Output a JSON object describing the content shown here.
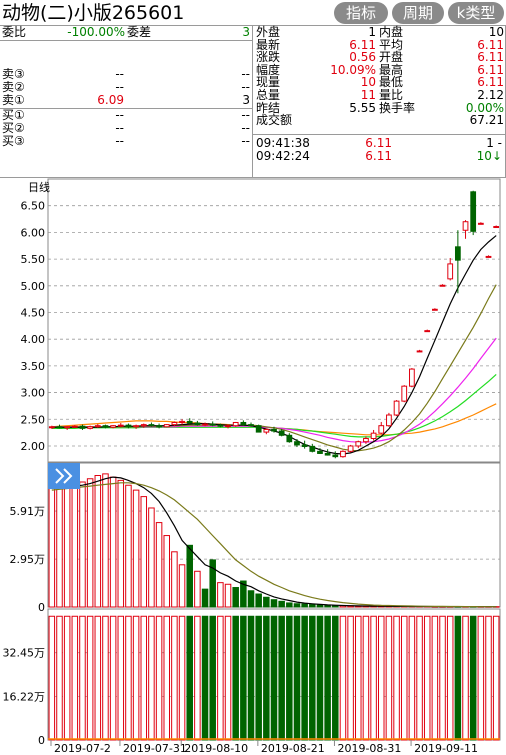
{
  "header": {
    "title": "动物(二)小版265601",
    "buttons": [
      "指标",
      "周期",
      "k类型"
    ]
  },
  "order_book": {
    "weibi_label": "委比",
    "weibi_value": "-100.00%",
    "weicha_label": "委差",
    "weicha_value": "3",
    "sells": [
      {
        "label": "卖③",
        "price": "--",
        "vol": "--"
      },
      {
        "label": "卖②",
        "price": "--",
        "vol": "--"
      },
      {
        "label": "卖①",
        "price": "6.09",
        "vol": "3"
      }
    ],
    "buys": [
      {
        "label": "买①",
        "price": "--",
        "vol": "--"
      },
      {
        "label": "买②",
        "price": "--",
        "vol": "--"
      },
      {
        "label": "买③",
        "price": "--",
        "vol": "--"
      }
    ]
  },
  "stats": {
    "rows": [
      {
        "l1": "外盘",
        "v1": "1",
        "l2": "内盘",
        "v2": "10",
        "c1": "black",
        "c2": "black"
      },
      {
        "l1": "最新",
        "v1": "6.11",
        "l2": "平均",
        "v2": "6.11",
        "c1": "red",
        "c2": "red"
      },
      {
        "l1": "涨跌",
        "v1": "0.56",
        "l2": "开盘",
        "v2": "6.11",
        "c1": "red",
        "c2": "red"
      },
      {
        "l1": "幅度",
        "v1": "10.09%",
        "l2": "最高",
        "v2": "6.11",
        "c1": "red",
        "c2": "red"
      },
      {
        "l1": "现量",
        "v1": "10",
        "l2": "最低",
        "v2": "6.11",
        "c1": "red",
        "c2": "red"
      },
      {
        "l1": "总量",
        "v1": "11",
        "l2": "量比",
        "v2": "2.12",
        "c1": "red",
        "c2": "black"
      },
      {
        "l1": "昨结",
        "v1": "5.55",
        "l2": "换手率",
        "v2": "0.00%",
        "c1": "black",
        "c2": "green"
      },
      {
        "l1": "成交额",
        "v1": "",
        "l2": "",
        "v2": "67.21",
        "c1": "black",
        "c2": "black"
      }
    ],
    "ticks": [
      {
        "time": "09:41:38",
        "price": "6.11",
        "vol": "1 -"
      },
      {
        "time": "09:42:24",
        "price": "6.11",
        "vol": "10↓"
      }
    ]
  },
  "colors": {
    "up": "#e0000f",
    "down": "#006400",
    "ma5": "#000000",
    "ma10": "#7a7a1a",
    "ma20": "#ee22ee",
    "ma30": "#22dd22",
    "ma60": "#ff8800",
    "grid": "#9a9a9a"
  },
  "chart_data": [
    {
      "type": "candlestick",
      "period_label": "日线",
      "y_ticks": [
        "6.50",
        "6.00",
        "5.50",
        "5.00",
        "4.50",
        "4.00",
        "3.50",
        "3.00",
        "2.50",
        "2.00"
      ],
      "ylim": [
        1.7,
        7.0
      ],
      "candles": [
        [
          2.35,
          2.38,
          2.32,
          2.36
        ],
        [
          2.36,
          2.4,
          2.33,
          2.34
        ],
        [
          2.34,
          2.37,
          2.3,
          2.36
        ],
        [
          2.36,
          2.39,
          2.34,
          2.37
        ],
        [
          2.37,
          2.4,
          2.3,
          2.33
        ],
        [
          2.33,
          2.38,
          2.31,
          2.36
        ],
        [
          2.36,
          2.41,
          2.34,
          2.38
        ],
        [
          2.38,
          2.4,
          2.33,
          2.35
        ],
        [
          2.35,
          2.39,
          2.33,
          2.38
        ],
        [
          2.38,
          2.43,
          2.35,
          2.39
        ],
        [
          2.39,
          2.42,
          2.33,
          2.36
        ],
        [
          2.36,
          2.4,
          2.32,
          2.38
        ],
        [
          2.38,
          2.42,
          2.34,
          2.4
        ],
        [
          2.4,
          2.44,
          2.36,
          2.38
        ],
        [
          2.38,
          2.42,
          2.33,
          2.36
        ],
        [
          2.36,
          2.41,
          2.35,
          2.4
        ],
        [
          2.4,
          2.46,
          2.37,
          2.44
        ],
        [
          2.44,
          2.5,
          2.4,
          2.46
        ],
        [
          2.46,
          2.52,
          2.41,
          2.43
        ],
        [
          2.43,
          2.47,
          2.38,
          2.4
        ],
        [
          2.4,
          2.44,
          2.37,
          2.41
        ],
        [
          2.41,
          2.46,
          2.37,
          2.39
        ],
        [
          2.39,
          2.42,
          2.35,
          2.37
        ],
        [
          2.37,
          2.4,
          2.33,
          2.38
        ],
        [
          2.38,
          2.45,
          2.36,
          2.44
        ],
        [
          2.44,
          2.48,
          2.38,
          2.4
        ],
        [
          2.4,
          2.44,
          2.36,
          2.38
        ],
        [
          2.38,
          2.4,
          2.3,
          2.26
        ],
        [
          2.26,
          2.33,
          2.22,
          2.31
        ],
        [
          2.31,
          2.36,
          2.25,
          2.28
        ],
        [
          2.28,
          2.32,
          2.18,
          2.2
        ],
        [
          2.2,
          2.24,
          2.06,
          2.08
        ],
        [
          2.08,
          2.13,
          1.98,
          2.02
        ],
        [
          2.02,
          2.1,
          1.95,
          1.99
        ],
        [
          1.99,
          2.04,
          1.88,
          1.9
        ],
        [
          1.9,
          1.96,
          1.85,
          1.86
        ],
        [
          1.86,
          1.94,
          1.82,
          1.83
        ],
        [
          1.83,
          1.9,
          1.77,
          1.8
        ],
        [
          1.8,
          1.92,
          1.78,
          1.9
        ],
        [
          1.9,
          2.02,
          1.88,
          2.0
        ],
        [
          2.0,
          2.1,
          1.96,
          2.08
        ],
        [
          2.08,
          2.18,
          2.04,
          2.14
        ],
        [
          2.14,
          2.3,
          2.1,
          2.24
        ],
        [
          2.24,
          2.45,
          2.22,
          2.38
        ],
        [
          2.38,
          2.62,
          2.36,
          2.58
        ],
        [
          2.58,
          2.86,
          2.56,
          2.84
        ],
        [
          2.84,
          3.14,
          2.82,
          3.12
        ],
        [
          3.12,
          3.46,
          3.1,
          3.44
        ],
        [
          3.78,
          3.8,
          3.76,
          3.78
        ],
        [
          4.16,
          4.18,
          4.14,
          4.16
        ],
        [
          4.56,
          4.58,
          4.54,
          4.56
        ],
        [
          5.01,
          5.03,
          4.99,
          5.01
        ],
        [
          5.13,
          5.52,
          5.1,
          5.41
        ],
        [
          5.73,
          6.04,
          4.86,
          5.48
        ],
        [
          6.04,
          6.23,
          5.88,
          6.2
        ],
        [
          6.76,
          6.78,
          5.95,
          6.02
        ],
        [
          6.17,
          6.19,
          6.15,
          6.17
        ],
        [
          5.55,
          5.57,
          5.53,
          5.55
        ],
        [
          6.11,
          6.13,
          6.09,
          6.11
        ]
      ],
      "ma5": [
        2.35,
        2.35,
        2.35,
        2.35,
        2.35,
        2.35,
        2.35,
        2.36,
        2.36,
        2.37,
        2.37,
        2.37,
        2.38,
        2.38,
        2.38,
        2.38,
        2.39,
        2.4,
        2.41,
        2.42,
        2.42,
        2.41,
        2.4,
        2.39,
        2.39,
        2.39,
        2.38,
        2.35,
        2.32,
        2.28,
        2.24,
        2.18,
        2.1,
        2.03,
        1.98,
        1.93,
        1.89,
        1.86,
        1.85,
        1.87,
        1.92,
        2.0,
        2.08,
        2.18,
        2.32,
        2.52,
        2.74,
        3.0,
        3.3,
        3.64,
        3.98,
        4.32,
        4.66,
        4.96,
        5.22,
        5.48,
        5.68,
        5.82,
        5.94
      ],
      "ma10": [
        2.36,
        2.36,
        2.36,
        2.36,
        2.36,
        2.36,
        2.36,
        2.36,
        2.36,
        2.36,
        2.36,
        2.36,
        2.37,
        2.37,
        2.37,
        2.37,
        2.38,
        2.38,
        2.39,
        2.39,
        2.39,
        2.39,
        2.39,
        2.39,
        2.39,
        2.39,
        2.39,
        2.38,
        2.36,
        2.34,
        2.31,
        2.27,
        2.22,
        2.17,
        2.12,
        2.07,
        2.02,
        1.98,
        1.94,
        1.92,
        1.91,
        1.93,
        1.96,
        2.01,
        2.08,
        2.18,
        2.3,
        2.44,
        2.6,
        2.8,
        3.02,
        3.26,
        3.5,
        3.74,
        3.98,
        4.22,
        4.48,
        4.76,
        5.02
      ],
      "ma20": [
        2.36,
        2.36,
        2.36,
        2.36,
        2.36,
        2.36,
        2.36,
        2.36,
        2.36,
        2.36,
        2.36,
        2.36,
        2.36,
        2.36,
        2.36,
        2.36,
        2.36,
        2.37,
        2.37,
        2.37,
        2.37,
        2.37,
        2.37,
        2.37,
        2.37,
        2.37,
        2.37,
        2.36,
        2.35,
        2.34,
        2.33,
        2.31,
        2.29,
        2.26,
        2.23,
        2.2,
        2.16,
        2.13,
        2.1,
        2.08,
        2.07,
        2.07,
        2.08,
        2.1,
        2.13,
        2.18,
        2.24,
        2.32,
        2.41,
        2.52,
        2.65,
        2.79,
        2.94,
        3.1,
        3.27,
        3.45,
        3.64,
        3.83,
        4.02
      ],
      "ma30": [
        2.33,
        2.33,
        2.33,
        2.33,
        2.34,
        2.34,
        2.34,
        2.34,
        2.34,
        2.34,
        2.34,
        2.34,
        2.35,
        2.35,
        2.35,
        2.35,
        2.35,
        2.35,
        2.35,
        2.35,
        2.35,
        2.35,
        2.35,
        2.35,
        2.35,
        2.35,
        2.35,
        2.35,
        2.35,
        2.34,
        2.33,
        2.32,
        2.31,
        2.29,
        2.28,
        2.26,
        2.24,
        2.22,
        2.2,
        2.18,
        2.17,
        2.17,
        2.17,
        2.18,
        2.2,
        2.22,
        2.25,
        2.29,
        2.34,
        2.4,
        2.47,
        2.55,
        2.64,
        2.74,
        2.85,
        2.97,
        3.09,
        3.21,
        3.34
      ],
      "ma60": [
        2.36,
        2.37,
        2.38,
        2.39,
        2.4,
        2.41,
        2.42,
        2.43,
        2.44,
        2.45,
        2.46,
        2.47,
        2.47,
        2.47,
        2.46,
        2.46,
        2.45,
        2.44,
        2.44,
        2.43,
        2.42,
        2.41,
        2.41,
        2.4,
        2.39,
        2.38,
        2.37,
        2.36,
        2.35,
        2.34,
        2.33,
        2.32,
        2.31,
        2.3,
        2.28,
        2.27,
        2.26,
        2.25,
        2.24,
        2.23,
        2.22,
        2.21,
        2.21,
        2.21,
        2.21,
        2.22,
        2.23,
        2.24,
        2.26,
        2.29,
        2.32,
        2.36,
        2.41,
        2.46,
        2.52,
        2.58,
        2.65,
        2.72,
        2.79
      ]
    },
    {
      "type": "bar",
      "y_ticks": [
        "5.91万",
        "2.95万",
        "0"
      ],
      "ylim": [
        0,
        8.87
      ],
      "values": [
        7.3,
        7.4,
        7.5,
        7.6,
        7.7,
        7.9,
        8.1,
        8.2,
        8.0,
        7.8,
        7.5,
        7.2,
        6.8,
        6.1,
        5.2,
        4.4,
        3.4,
        2.6,
        3.8,
        2.2,
        1.1,
        2.9,
        1.5,
        1.4,
        1.2,
        1.6,
        1.0,
        0.8,
        0.6,
        0.45,
        0.35,
        0.25,
        0.2,
        0.18,
        0.15,
        0.12,
        0.1,
        0.09,
        0.08,
        0.07,
        0.06,
        0.05,
        0.05,
        0.04,
        0.04,
        0.04,
        0.03,
        0.03,
        0.03,
        0.03,
        0.02,
        0.02,
        0.02,
        0.02,
        0.02,
        0.02,
        0.02,
        0.02,
        0.02
      ],
      "directions": [
        "u",
        "u",
        "u",
        "u",
        "u",
        "u",
        "u",
        "u",
        "u",
        "u",
        "u",
        "u",
        "u",
        "u",
        "u",
        "u",
        "u",
        "u",
        "d",
        "u",
        "d",
        "d",
        "u",
        "u",
        "d",
        "d",
        "d",
        "d",
        "d",
        "d",
        "d",
        "d",
        "d",
        "d",
        "d",
        "d",
        "d",
        "d",
        "u",
        "u",
        "u",
        "u",
        "u",
        "u",
        "u",
        "u",
        "u",
        "u",
        "u",
        "u",
        "u",
        "u",
        "u",
        "d",
        "u",
        "d",
        "u",
        "u",
        "u"
      ],
      "ma1": [
        7.3,
        7.35,
        7.4,
        7.45,
        7.5,
        7.6,
        7.75,
        7.9,
        8.0,
        7.95,
        7.8,
        7.6,
        7.35,
        7.0,
        6.5,
        5.8,
        5.0,
        4.1,
        3.6,
        3.1,
        2.6,
        2.4,
        2.1,
        1.9,
        1.6,
        1.4,
        1.25,
        1.0,
        0.8,
        0.62,
        0.5,
        0.4,
        0.3,
        0.24,
        0.2,
        0.16,
        0.13,
        0.11,
        0.09,
        0.08,
        0.07,
        0.06,
        0.055,
        0.05,
        0.045,
        0.04,
        0.035,
        0.03,
        0.03,
        0.03,
        0.025,
        0.02,
        0.02,
        0.02,
        0.02,
        0.02,
        0.02,
        0.02,
        0.02
      ],
      "ma2": [
        7.2,
        7.25,
        7.3,
        7.35,
        7.4,
        7.45,
        7.5,
        7.55,
        7.6,
        7.65,
        7.65,
        7.6,
        7.5,
        7.35,
        7.15,
        6.9,
        6.6,
        6.2,
        5.8,
        5.4,
        4.9,
        4.4,
        3.9,
        3.4,
        2.9,
        2.55,
        2.2,
        1.9,
        1.65,
        1.4,
        1.2,
        1.0,
        0.85,
        0.7,
        0.58,
        0.48,
        0.4,
        0.33,
        0.27,
        0.22,
        0.18,
        0.15,
        0.12,
        0.1,
        0.09,
        0.08,
        0.07,
        0.06,
        0.05,
        0.045,
        0.04,
        0.035,
        0.03,
        0.03,
        0.025,
        0.025,
        0.02,
        0.02,
        0.02
      ]
    },
    {
      "type": "bar",
      "y_ticks": [
        "32.45万",
        "16.22万",
        "0"
      ],
      "ylim": [
        0,
        48.7
      ],
      "value_label": "成交额",
      "values": [
        46,
        46,
        46,
        46,
        46,
        46,
        46,
        46,
        46,
        46,
        46,
        46,
        46,
        46,
        46,
        46,
        46,
        46,
        46,
        46,
        46,
        46,
        46,
        46,
        46,
        46,
        46,
        46,
        46,
        46,
        46,
        46,
        46,
        46,
        46,
        46,
        46,
        46,
        46,
        46,
        46,
        46,
        46,
        46,
        46,
        46,
        46,
        46,
        46,
        46,
        46,
        46,
        46,
        46,
        46,
        46,
        46,
        46,
        46
      ],
      "directions": [
        "u",
        "u",
        "u",
        "u",
        "u",
        "u",
        "u",
        "u",
        "u",
        "u",
        "u",
        "u",
        "u",
        "u",
        "u",
        "u",
        "u",
        "u",
        "d",
        "u",
        "d",
        "d",
        "u",
        "u",
        "d",
        "d",
        "d",
        "d",
        "d",
        "d",
        "d",
        "d",
        "d",
        "d",
        "d",
        "d",
        "d",
        "d",
        "u",
        "u",
        "u",
        "u",
        "u",
        "u",
        "u",
        "u",
        "u",
        "u",
        "u",
        "u",
        "u",
        "u",
        "u",
        "d",
        "u",
        "d",
        "u",
        "u",
        "u"
      ]
    }
  ],
  "x_axis": {
    "dates": [
      "2019-07-2",
      "2019-07-31",
      "2019-08-10",
      "2019-08-21",
      "2019-08-31",
      "2019-09-11"
    ]
  }
}
